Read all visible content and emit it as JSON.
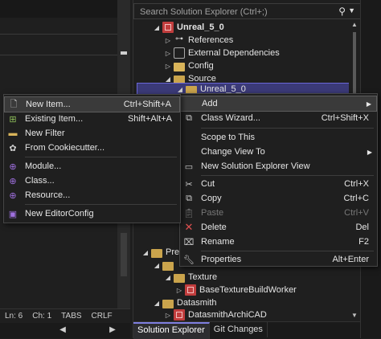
{
  "editor": {
    "status": {
      "ln": "Ln: 6",
      "ch": "Ch: 1",
      "tabs": "TABS",
      "crlf": "CRLF"
    }
  },
  "solution_explorer": {
    "search_placeholder": "Search Solution Explorer (Ctrl+;)",
    "tree": {
      "project": "Unreal_5_0",
      "references": "References",
      "external_dependencies": "External Dependencies",
      "config": "Config",
      "source": "Source",
      "unreal_5_0_selected": "Unreal_5_0",
      "pre_partial": "Pre",
      "texture": "Texture",
      "base_texture_build_worker": "BaseTextureBuildWorker",
      "datasmith": "Datasmith",
      "datasmith_archicad": "DatasmithArchiCAD"
    },
    "tabs": {
      "solution_explorer": "Solution Explorer",
      "git_changes": "Git Changes"
    }
  },
  "context_menu": {
    "add": {
      "label": "Add"
    },
    "class_wizard": {
      "label": "Class Wizard...",
      "shortcut": "Ctrl+Shift+X"
    },
    "scope_to_this": {
      "label": "Scope to This"
    },
    "change_view_to": {
      "label": "Change View To"
    },
    "new_se_view": {
      "label": "New Solution Explorer View"
    },
    "cut": {
      "label": "Cut",
      "shortcut": "Ctrl+X"
    },
    "copy": {
      "label": "Copy",
      "shortcut": "Ctrl+C"
    },
    "paste": {
      "label": "Paste",
      "shortcut": "Ctrl+V"
    },
    "delete": {
      "label": "Delete",
      "shortcut": "Del"
    },
    "rename": {
      "label": "Rename",
      "shortcut": "F2"
    },
    "properties": {
      "label": "Properties",
      "shortcut": "Alt+Enter"
    }
  },
  "add_submenu": {
    "new_item": {
      "label": "New Item...",
      "shortcut": "Ctrl+Shift+A"
    },
    "existing_item": {
      "label": "Existing Item...",
      "shortcut": "Shift+Alt+A"
    },
    "new_filter": {
      "label": "New Filter"
    },
    "from_cookiecutter": {
      "label": "From Cookiecutter..."
    },
    "module": {
      "label": "Module..."
    },
    "class": {
      "label": "Class..."
    },
    "resource": {
      "label": "Resource..."
    },
    "new_editorconfig": {
      "label": "New EditorConfig"
    }
  }
}
